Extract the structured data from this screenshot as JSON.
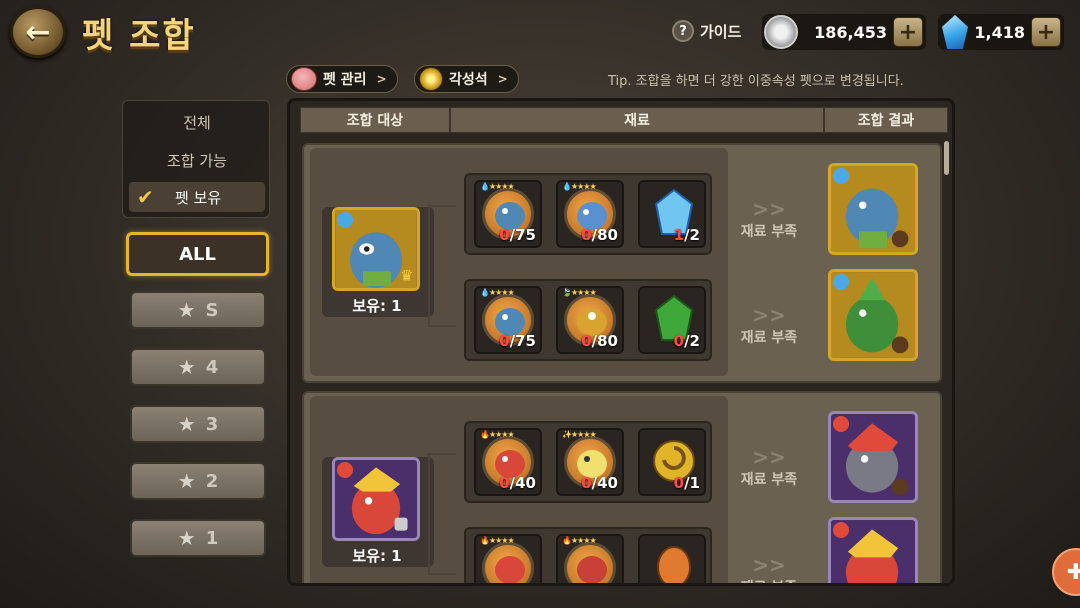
{
  "header": {
    "title": "펫 조합",
    "guide_label": "가이드",
    "gold": "186,453",
    "gems": "1,418"
  },
  "nav": {
    "pet_manage": "펫 관리",
    "awaken_stone": "각성석",
    "tip": "Tip. 조합을 하면 더 강한 이중속성 펫으로 변경됩니다."
  },
  "filter": {
    "all_label": "전체",
    "craftable_label": "조합 가능",
    "owned_label": "펫 보유"
  },
  "grade_buttons": [
    "ALL",
    "S",
    "4",
    "3",
    "2",
    "1"
  ],
  "table_headers": {
    "target": "조합 대상",
    "materials": "재료",
    "result": "조합 결과"
  },
  "rows": [
    {
      "owned": "보유: 1",
      "recipes": [
        {
          "status": "재료 부족",
          "materials": [
            {
              "have": "0",
              "need": "/75"
            },
            {
              "have": "0",
              "need": "/80"
            },
            {
              "have": "1",
              "need": "/2"
            }
          ]
        },
        {
          "status": "재료 부족",
          "materials": [
            {
              "have": "0",
              "need": "/75"
            },
            {
              "have": "0",
              "need": "/80"
            },
            {
              "have": "0",
              "need": "/2"
            }
          ]
        }
      ]
    },
    {
      "owned": "보유: 1",
      "recipes": [
        {
          "status": "재료 부족",
          "materials": [
            {
              "have": "0",
              "need": "/40"
            },
            {
              "have": "0",
              "need": "/40"
            },
            {
              "have": "0",
              "need": "/1"
            }
          ]
        },
        {
          "status": "재료 부족",
          "materials": [
            {
              "have": "",
              "need": ""
            },
            {
              "have": "",
              "need": ""
            },
            {
              "have": "",
              "need": ""
            }
          ]
        }
      ]
    }
  ],
  "colors": {
    "accent_gold": "#e7b42a",
    "count_red": "#ff4a4a",
    "water": "#4aa8e6",
    "fire": "#e04a3a",
    "earth": "#3ea83a"
  }
}
